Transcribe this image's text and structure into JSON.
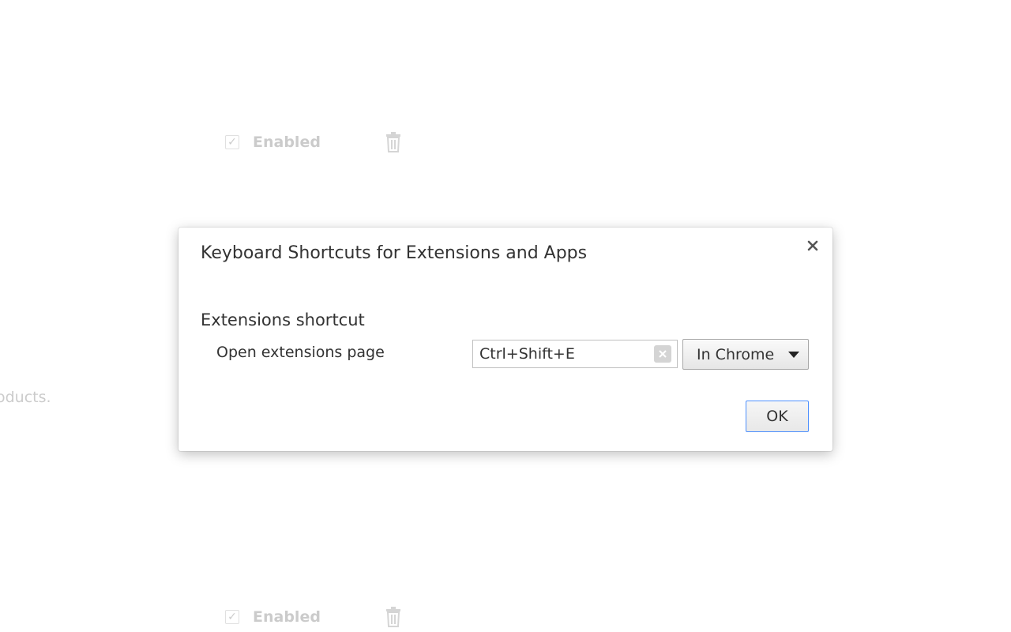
{
  "background": {
    "rows": [
      {
        "enabled_label": "Enabled",
        "checked": true
      },
      {
        "enabled_label": "Enabled",
        "checked": true
      }
    ],
    "partial_text": "oducts."
  },
  "dialog": {
    "title": "Keyboard Shortcuts for Extensions and Apps",
    "close_label": "×",
    "section_title": "Extensions shortcut",
    "command": {
      "label": "Open extensions page",
      "shortcut": "Ctrl+Shift+E",
      "scope": "In Chrome"
    },
    "ok_label": "OK"
  },
  "colors": {
    "focus_border": "#4d90fe",
    "text": "#333333"
  }
}
